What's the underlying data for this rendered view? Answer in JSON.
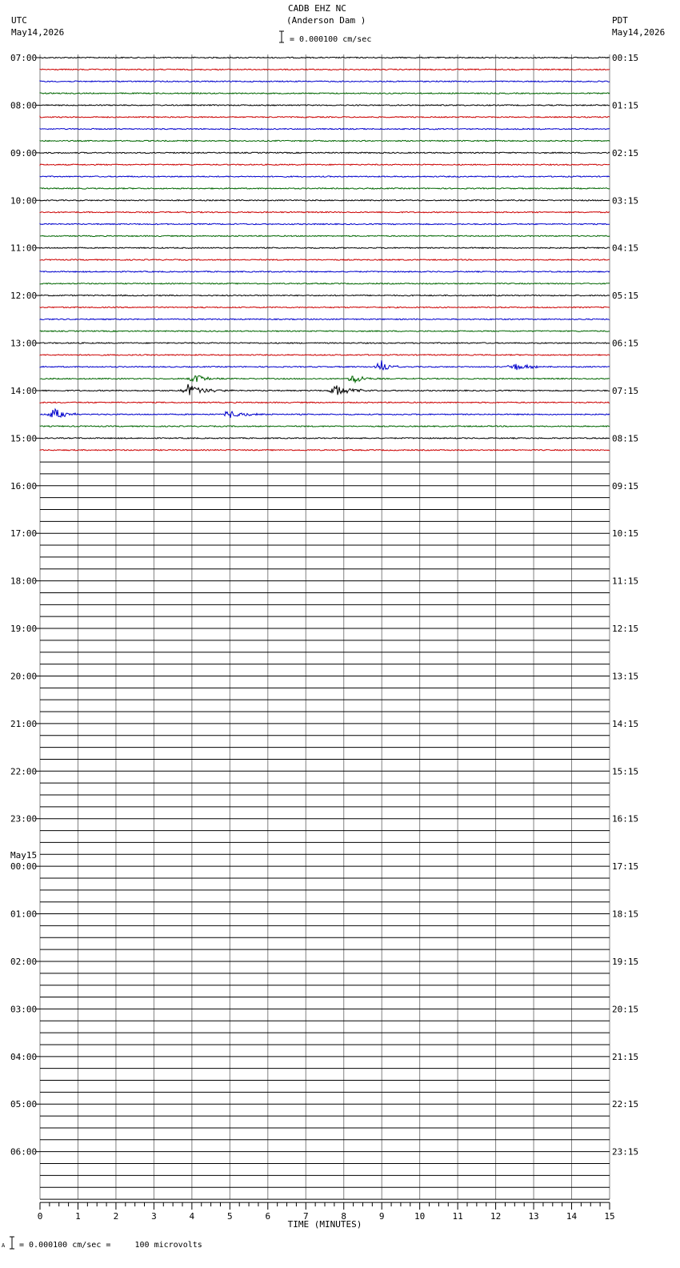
{
  "header": {
    "station": "CADB EHZ NC",
    "location": "(Anderson Dam )",
    "scale_text": "= 0.000100 cm/sec",
    "left_tz": "UTC",
    "left_date": "May14,2026",
    "right_tz": "PDT",
    "right_date": "May14,2026"
  },
  "footer": {
    "prefix": "A",
    "scale_text": "= 0.000100 cm/sec =     100 microvolts"
  },
  "colors": {
    "trace": [
      "#000000",
      "#cc0000",
      "#0000cc",
      "#006600"
    ],
    "grid": "#808080"
  },
  "chart_data": {
    "type": "seismogram",
    "title": "CADB EHZ NC (Anderson Dam )",
    "xlabel": "TIME (MINUTES)",
    "xlim": [
      0,
      15
    ],
    "x_ticks": [
      "0",
      "1",
      "2",
      "3",
      "4",
      "5",
      "6",
      "7",
      "8",
      "9",
      "10",
      "11",
      "12",
      "13",
      "14",
      "15"
    ],
    "minutes_per_trace": 15,
    "traces_per_hour": 4,
    "trace_count": 96,
    "recorded_trace_count": 34,
    "hours_utc": [
      "07:00",
      "08:00",
      "09:00",
      "10:00",
      "11:00",
      "12:00",
      "13:00",
      "14:00",
      "15:00",
      "16:00",
      "17:00",
      "18:00",
      "19:00",
      "20:00",
      "21:00",
      "22:00",
      "23:00",
      "00:00",
      "01:00",
      "02:00",
      "03:00",
      "04:00",
      "05:00",
      "06:00"
    ],
    "hours_pdt": [
      "00:15",
      "01:15",
      "02:15",
      "03:15",
      "04:15",
      "05:15",
      "06:15",
      "07:15",
      "08:15",
      "09:15",
      "10:15",
      "11:15",
      "12:15",
      "13:15",
      "14:15",
      "15:15",
      "16:15",
      "17:15",
      "18:15",
      "19:15",
      "20:15",
      "21:15",
      "22:15",
      "23:15"
    ],
    "date_change_label": "May15",
    "date_change_hour_index": 17,
    "events": [
      {
        "trace": 26,
        "minute": 9.0,
        "amplitude": 8,
        "duration_min": 0.6
      },
      {
        "trace": 26,
        "minute": 12.5,
        "amplitude": 5,
        "duration_min": 1.0
      },
      {
        "trace": 27,
        "minute": 4.1,
        "amplitude": 6,
        "duration_min": 0.7
      },
      {
        "trace": 27,
        "minute": 8.3,
        "amplitude": 6,
        "duration_min": 0.7
      },
      {
        "trace": 28,
        "minute": 3.9,
        "amplitude": 8,
        "duration_min": 1.2
      },
      {
        "trace": 28,
        "minute": 7.8,
        "amplitude": 7,
        "duration_min": 1.1
      },
      {
        "trace": 30,
        "minute": 0.4,
        "amplitude": 7,
        "duration_min": 0.8
      },
      {
        "trace": 30,
        "minute": 5.0,
        "amplitude": 5,
        "duration_min": 1.2
      }
    ]
  }
}
